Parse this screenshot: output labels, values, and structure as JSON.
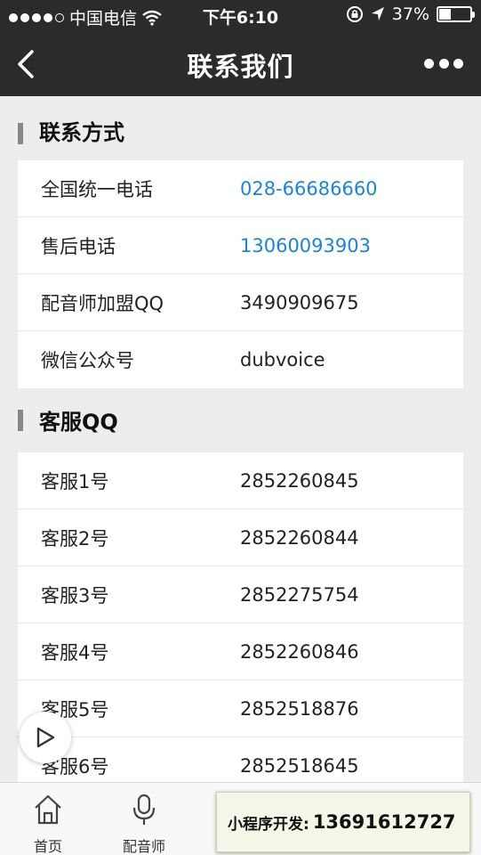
{
  "status_bar": {
    "carrier": "中国电信",
    "time": "下午6:10",
    "battery_percent": "37%",
    "battery_level": 0.37,
    "signal_dots": 5,
    "signal_filled": 4
  },
  "nav": {
    "title": "联系我们"
  },
  "contact_section": {
    "title": "联系方式",
    "rows": [
      {
        "label": "全国统一电话",
        "value": "028-66686660"
      },
      {
        "label": "售后电话",
        "value": "13060093903"
      },
      {
        "label": "配音师加盟QQ",
        "value": "3490909675"
      },
      {
        "label": "微信公众号",
        "value": "dubvoice"
      }
    ]
  },
  "service_section": {
    "title": "客服QQ",
    "rows": [
      {
        "label": "客服1号",
        "value": "2852260845"
      },
      {
        "label": "客服2号",
        "value": "2852260844"
      },
      {
        "label": "客服3号",
        "value": "2852275754"
      },
      {
        "label": "客服4号",
        "value": "2852260846"
      },
      {
        "label": "客服5号",
        "value": "2852518876"
      },
      {
        "label": "客服6号",
        "value": "2852518645"
      }
    ]
  },
  "tab_bar": {
    "tabs": [
      {
        "label": "首页",
        "icon": "home-icon"
      },
      {
        "label": "配音师",
        "icon": "microphone-icon"
      }
    ]
  },
  "promo": {
    "label": "小程序开发:",
    "phone": "13691612727"
  },
  "colors": {
    "header_bg": "#2b2b2e",
    "link": "#1f83d4",
    "page_bg": "#ededed"
  }
}
